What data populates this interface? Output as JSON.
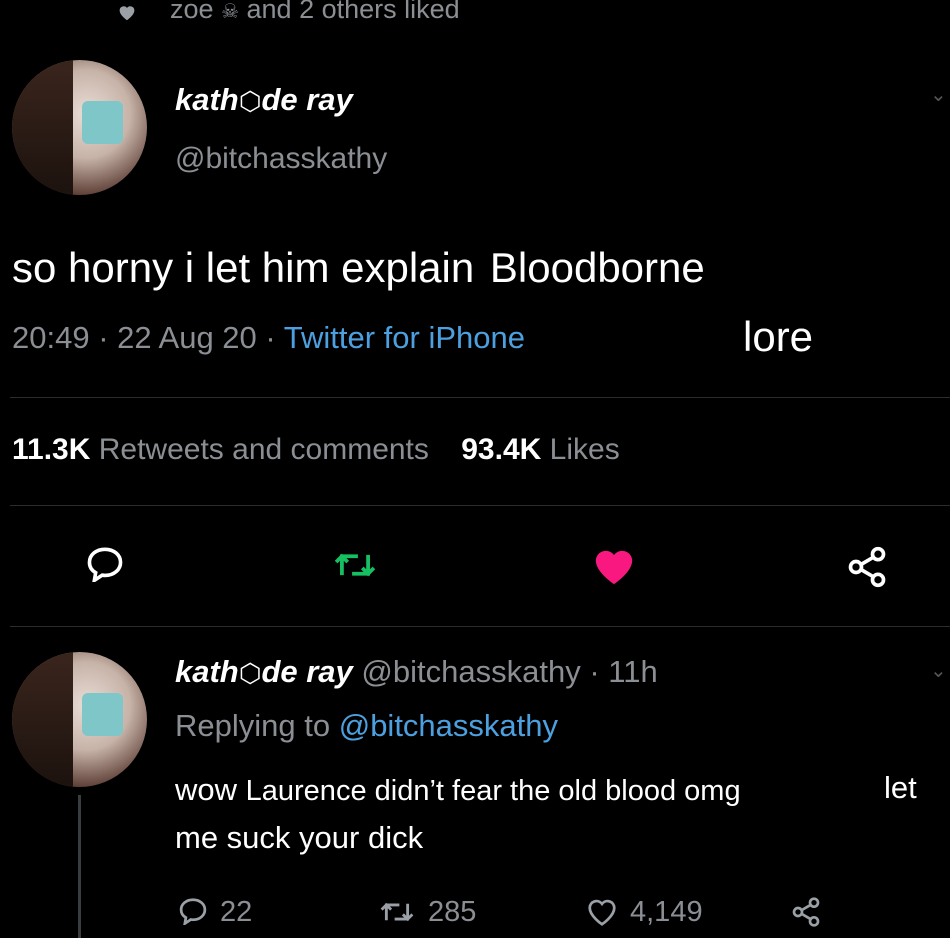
{
  "liked_bar": {
    "text_before": "zoe",
    "text_after": "and 2 others liked"
  },
  "tweet": {
    "display_name": "kath",
    "display_name_suffix": "de ray",
    "handle": "@bitchasskathy",
    "text": "so horny i let him explain",
    "overlay_text_1": "Bloodborne",
    "overlay_text_2": "lore",
    "time": "20:49",
    "date": "22 Aug 20",
    "source": "Twitter for iPhone",
    "retweets_count": "11.3K",
    "retweets_label": "Retweets and comments",
    "likes_count": "93.4K",
    "likes_label": "Likes"
  },
  "reply": {
    "display_name": "kath",
    "display_name_suffix": "de ray",
    "handle": "@bitchasskathy",
    "age": "11h",
    "replying_label": "Replying to",
    "replying_handle": "@bitchasskathy",
    "text_1": "wow",
    "overlay_text_1": "Laurence didn’t fear the old blood omg",
    "text_2": "let",
    "text_3": "me suck your dick",
    "replies_count": "22",
    "retweets_count": "285",
    "likes_count": "4,149"
  },
  "colors": {
    "background": "#000000",
    "like_active": "#f91880",
    "retweet": "#17bf63",
    "link": "#4da0e0",
    "muted": "#8b8f94"
  }
}
